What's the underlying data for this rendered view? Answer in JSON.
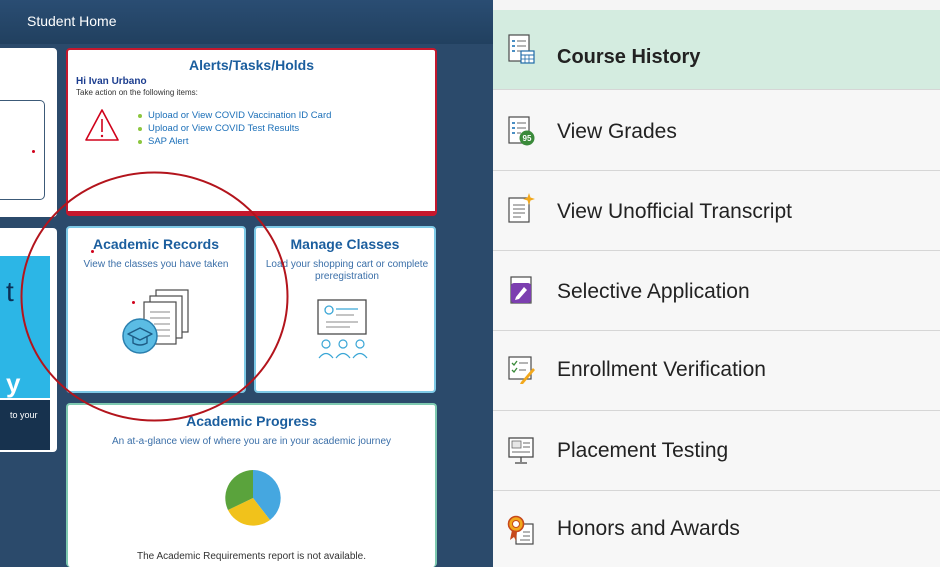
{
  "header": {
    "title": "Student Home"
  },
  "alerts": {
    "title": "Alerts/Tasks/Holds",
    "greeting": "Hi Ivan Urbano",
    "subtitle": "Take action on the following items:",
    "items": [
      "Upload or View COVID Vaccination ID Card",
      "Upload or View COVID Test Results",
      "SAP Alert"
    ]
  },
  "left_partial": {
    "big_letter_1": "t",
    "big_letter_2": "y",
    "caption": "to your"
  },
  "academic_records": {
    "title": "Academic Records",
    "subtitle": "View the classes you have taken"
  },
  "manage_classes": {
    "title": "Manage Classes",
    "subtitle": "Load your shopping cart or complete preregistration"
  },
  "academic_progress": {
    "title": "Academic Progress",
    "subtitle": "An at-a-glance view of where you are in your academic journey",
    "note": "The Academic Requirements report is not available."
  },
  "colors": {
    "header_bg": "#2a4d73",
    "alert_border": "#c5182d",
    "tile_border": "#7dc9e6",
    "title_blue": "#1b5e9e",
    "link_blue": "#1b6fb8",
    "annotation_red": "#b3141c",
    "active_nav_bg": "#d4ece0"
  },
  "nav": {
    "items": [
      {
        "label": "Course History",
        "icon": "course-history-icon",
        "active": true
      },
      {
        "label": "View Grades",
        "icon": "view-grades-icon",
        "active": false
      },
      {
        "label": "View Unofficial Transcript",
        "icon": "transcript-icon",
        "active": false
      },
      {
        "label": "Selective Application",
        "icon": "selective-application-icon",
        "active": false
      },
      {
        "label": "Enrollment Verification",
        "icon": "enrollment-verification-icon",
        "active": false
      },
      {
        "label": "Placement Testing",
        "icon": "placement-testing-icon",
        "active": false
      },
      {
        "label": "Honors and Awards",
        "icon": "honors-awards-icon",
        "active": false
      }
    ],
    "grade_badge": "95"
  }
}
